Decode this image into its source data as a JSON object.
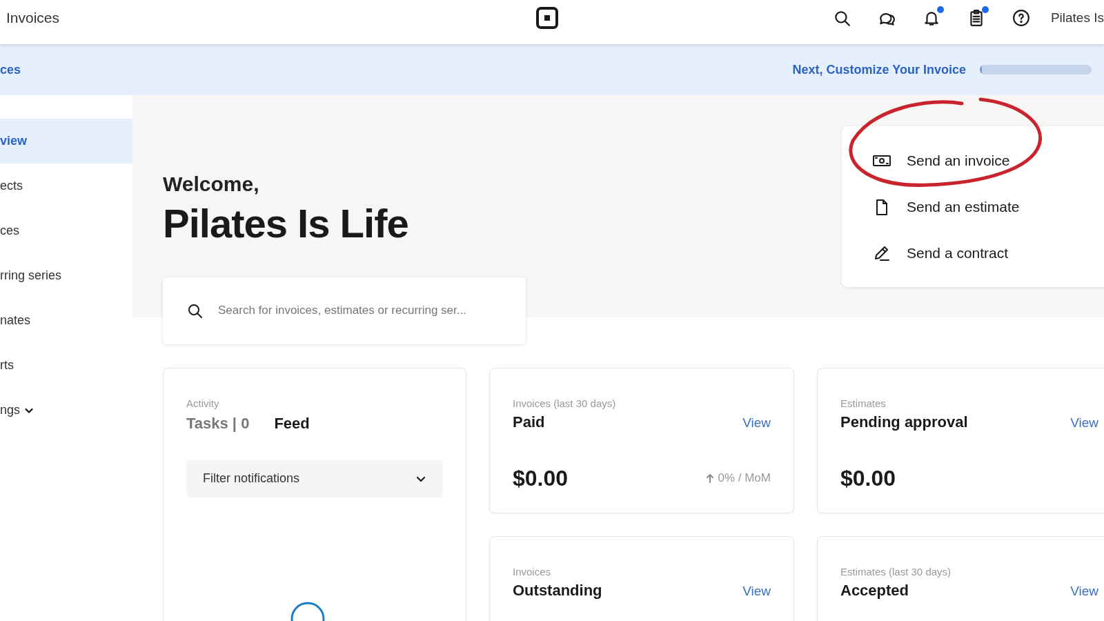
{
  "header": {
    "title": "Invoices",
    "account": "Pilates Is",
    "icons": [
      {
        "kind": "search",
        "badge": false
      },
      {
        "kind": "chat",
        "badge": false
      },
      {
        "kind": "bell",
        "badge": true
      },
      {
        "kind": "clipboard",
        "badge": true
      },
      {
        "kind": "help",
        "badge": false
      }
    ]
  },
  "banner": {
    "link": "ces",
    "next_step": "Next, Customize Your Invoice",
    "progress": {
      "level": 0.02
    }
  },
  "sidebar": {
    "items": [
      {
        "label": "view",
        "selected": true,
        "expandable": false
      },
      {
        "label": "ects",
        "selected": false,
        "expandable": false
      },
      {
        "label": "ces",
        "selected": false,
        "expandable": false
      },
      {
        "label": "rring series",
        "selected": false,
        "expandable": false
      },
      {
        "label": "nates",
        "selected": false,
        "expandable": false
      },
      {
        "label": "rts",
        "selected": false,
        "expandable": false
      },
      {
        "label": "ngs",
        "selected": false,
        "expandable": true
      }
    ]
  },
  "welcome": {
    "greeting": "Welcome,",
    "business": "Pilates Is Life"
  },
  "search": {
    "placeholder": "Search for invoices, estimates or recurring ser..."
  },
  "quick_actions": [
    {
      "kind": "invoice",
      "label": "Send an invoice"
    },
    {
      "kind": "estimate",
      "label": "Send an estimate"
    },
    {
      "kind": "contract",
      "label": "Send a contract"
    }
  ],
  "annotation": {
    "kind": "circle"
  },
  "activity": {
    "label": "Activity",
    "tabs": [
      {
        "label": "Tasks | 0",
        "selected": false
      },
      {
        "label": "Feed",
        "selected": true
      }
    ],
    "filter": {
      "value": "Filter notifications"
    },
    "loading": true
  },
  "cards": [
    {
      "label": "Invoices (last 30 days)",
      "title": "Paid",
      "link": "View",
      "amount": "$0.00",
      "trend": {
        "value": "0% / MoM"
      }
    },
    {
      "label": "Estimates",
      "title": "Pending approval",
      "link": "View",
      "amount": "$0.00"
    },
    {
      "label": "Invoices",
      "title": "Outstanding",
      "link": "View"
    },
    {
      "label": "Estimates (last 30 days)",
      "title": "Accepted",
      "link": "View"
    }
  ]
}
